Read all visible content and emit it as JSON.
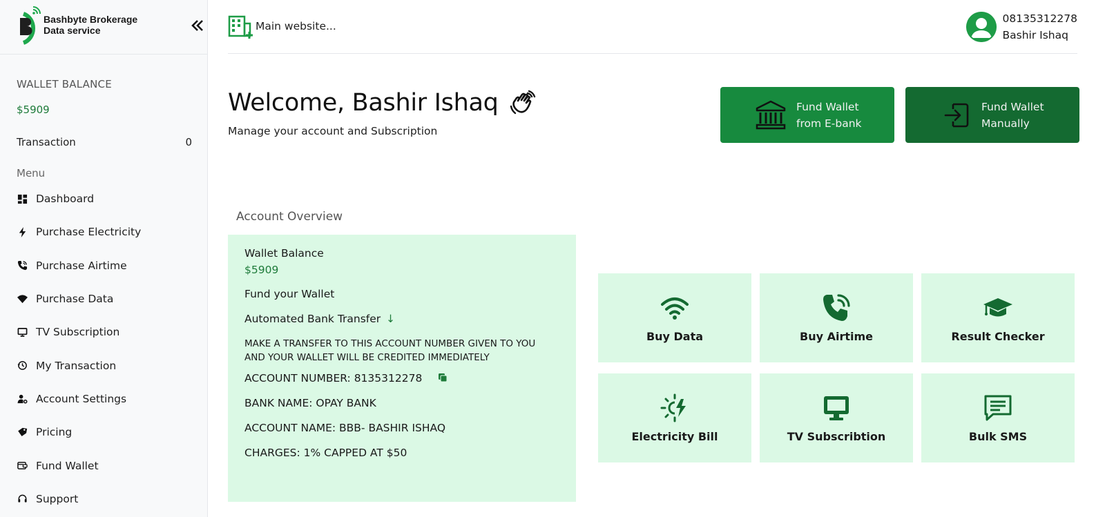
{
  "brand": {
    "line1": "Bashbyte Brokerage",
    "line2": "Data service",
    "collapse_icon": "chevron-double-left-icon"
  },
  "sidebar": {
    "wallet_title": "WALLET BALANCE",
    "wallet_amount": "$5909",
    "transaction_label": "Transaction",
    "transaction_count": "0",
    "menu_title": "Menu",
    "items": [
      {
        "label": "Dashboard",
        "icon": "dashboard-icon"
      },
      {
        "label": "Purchase Electricity",
        "icon": "bolt-icon"
      },
      {
        "label": "Purchase Airtime",
        "icon": "phone-icon"
      },
      {
        "label": "Purchase Data",
        "icon": "wifi-icon"
      },
      {
        "label": "TV Subscription",
        "icon": "monitor-icon"
      },
      {
        "label": "My Transaction",
        "icon": "history-icon"
      },
      {
        "label": "Account Settings",
        "icon": "user-gear-icon"
      },
      {
        "label": "Pricing",
        "icon": "tags-icon"
      },
      {
        "label": "Fund Wallet",
        "icon": "wallet-icon"
      },
      {
        "label": "Support",
        "icon": "headset-icon"
      }
    ]
  },
  "header": {
    "site_link": "Main website...",
    "phone": "08135312278",
    "user_name": "Bashir Ishaq"
  },
  "welcome": {
    "title": "Welcome, Bashir Ishaq",
    "subtitle": "Manage your account and Subscription"
  },
  "actions": {
    "ebank_line1": "Fund Wallet",
    "ebank_line2": "from E-bank",
    "manual_line1": "Fund Wallet",
    "manual_line2": "Manually"
  },
  "overview": {
    "title": "Account Overview",
    "wallet_label": "Wallet Balance",
    "wallet_amount": "$5909",
    "fund_label": "Fund your Wallet",
    "auto_transfer": "Automated Bank Transfer",
    "instruction": "MAKE A TRANSFER TO THIS ACCOUNT NUMBER GIVEN TO YOU AND YOUR WALLET WILL BE CREDITED IMMEDIATELY",
    "account_number": "ACCOUNT NUMBER: 8135312278",
    "bank_name": "BANK NAME: OPAY BANK",
    "account_name": "ACCOUNT NAME: BBB- BASHIR ISHAQ",
    "charges": "CHARGES: 1% CAPPED AT $50"
  },
  "services": [
    {
      "label": "Buy Data",
      "icon": "wifi-icon"
    },
    {
      "label": "Buy Airtime",
      "icon": "phone-volume-icon"
    },
    {
      "label": "Result Checker",
      "icon": "graduation-cap-icon"
    },
    {
      "label": "Electricity Bill",
      "icon": "sun-bolt-icon"
    },
    {
      "label": "TV Subscribtion",
      "icon": "desktop-icon"
    },
    {
      "label": "Bulk SMS",
      "icon": "message-icon"
    }
  ],
  "colors": {
    "primary": "#178a3e",
    "primary_dark": "#146a31",
    "tile_bg": "#dbf9e5",
    "money": "#1e7b3a"
  }
}
